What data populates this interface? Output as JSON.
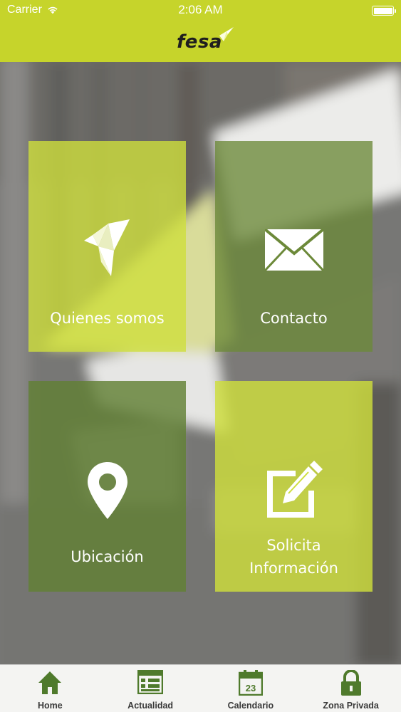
{
  "status_bar": {
    "carrier": "Carrier",
    "time": "2:06 AM"
  },
  "header": {
    "logo_text": "fesa",
    "brand_color": "#c6d42b"
  },
  "tiles": [
    {
      "label": "Quienes somos",
      "icon": "origami-bird-icon",
      "color": "#cede3c"
    },
    {
      "label": "Contacto",
      "icon": "envelope-icon",
      "color": "#6c8939"
    },
    {
      "label": "Ubicación",
      "icon": "map-pin-icon",
      "color": "#628034"
    },
    {
      "label_line1": "Solicita",
      "label_line2": "Información",
      "icon": "edit-form-icon",
      "color": "#cede3c"
    }
  ],
  "tabbar": {
    "icon_color": "#4f7a2c",
    "items": [
      {
        "label": "Home",
        "icon": "home-icon",
        "selected": true
      },
      {
        "label": "Actualidad",
        "icon": "news-grid-icon",
        "selected": false
      },
      {
        "label": "Calendario",
        "icon": "calendar-icon",
        "day": "23",
        "selected": false
      },
      {
        "label": "Zona Privada",
        "icon": "lock-icon",
        "selected": false
      }
    ]
  }
}
